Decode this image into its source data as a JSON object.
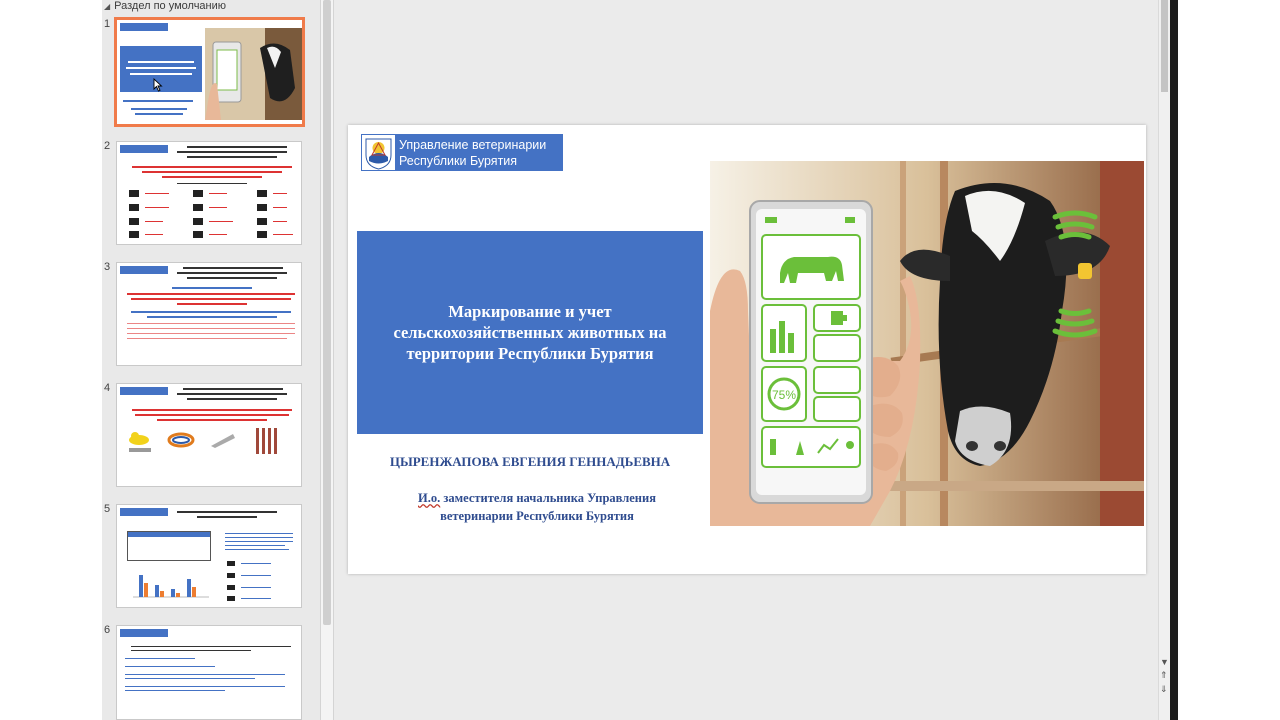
{
  "thumbnails_pane": {
    "section_label": "Раздел по умолчанию",
    "slide_numbers": [
      "1",
      "2",
      "3",
      "4",
      "5",
      "6"
    ]
  },
  "slide": {
    "logo_text_line1": "Управление ветеринарии",
    "logo_text_line2": "Республики Бурятия",
    "title_line1": "Маркирование и учет",
    "title_line2": "сельскохозяйственных животных на",
    "title_line3": "территории Республики Бурятия",
    "author": "ЦЫРЕНЖАПОВА ЕВГЕНИЯ ГЕННАДЬЕВНА",
    "position_prefix": "И.о.",
    "position_line1_rest": " заместителя начальника Управления",
    "position_line2": "ветеринарии Республики Бурятия",
    "phone_percent": "75%"
  },
  "colors": {
    "accent_blue": "#4472c4",
    "selected_thumb_border": "#f07b4a",
    "author_text": "#2f4c8f"
  }
}
